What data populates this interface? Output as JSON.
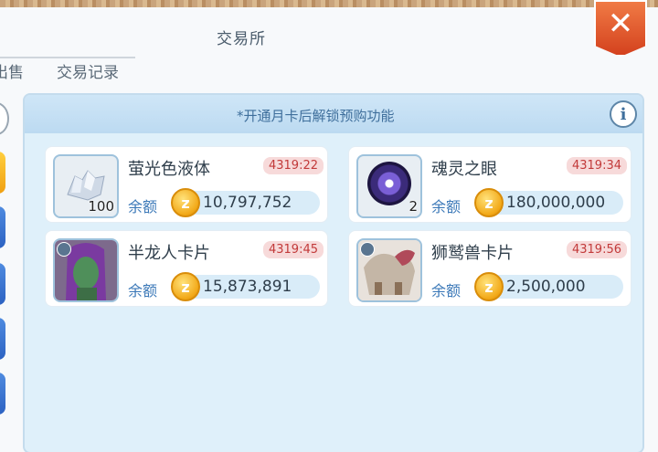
{
  "window": {
    "title": "交易所",
    "close_icon": "close-icon",
    "accent": "#e0552a"
  },
  "tabs": [
    {
      "label": "出售"
    },
    {
      "label": "交易记录"
    }
  ],
  "notice": {
    "text": "*开通月卡后解锁预购功能",
    "info_icon": "info-icon"
  },
  "balance_label": "余额",
  "coin_icon": "zeny-coin-icon",
  "items": [
    {
      "name": "萤光色液体",
      "timer": "4319:22",
      "balance": "10,797,752",
      "quantity": "100",
      "icon": "crystal-icon"
    },
    {
      "name": "魂灵之眼",
      "timer": "4319:34",
      "balance": "180,000,000",
      "quantity": "2",
      "icon": "soul-eye-icon"
    },
    {
      "name": "半龙人卡片",
      "timer": "4319:45",
      "balance": "15,873,891",
      "quantity": "",
      "icon": "half-dragon-card-icon"
    },
    {
      "name": "狮鹫兽卡片",
      "timer": "4319:56",
      "balance": "2,500,000",
      "quantity": "",
      "icon": "griffin-card-icon"
    }
  ]
}
